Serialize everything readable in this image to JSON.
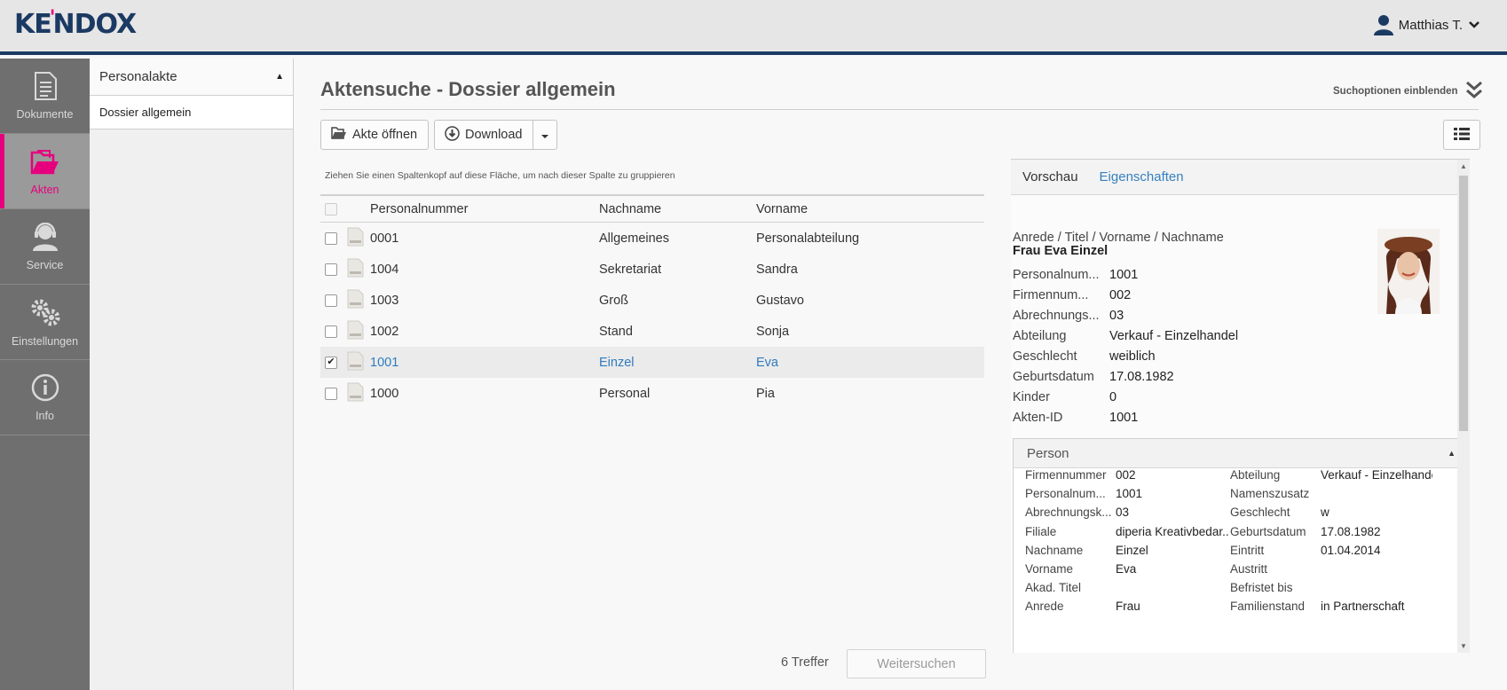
{
  "header": {
    "logo": "KENDOX",
    "user_name": "Matthias T.",
    "colors": {
      "brand_navy": "#1b3a63",
      "brand_pink": "#e6007e",
      "link_blue": "#2f7bbf"
    }
  },
  "leftnav": {
    "items": [
      {
        "label": "Dokumente",
        "icon": "document-icon"
      },
      {
        "label": "Akten",
        "icon": "folder-icon",
        "active": true
      },
      {
        "label": "Service",
        "icon": "headset-icon"
      },
      {
        "label": "Einstellungen",
        "icon": "gears-icon"
      },
      {
        "label": "Info",
        "icon": "info-icon"
      }
    ]
  },
  "subnav": {
    "header": "Personalakte",
    "items": [
      "Dossier allgemein"
    ]
  },
  "main": {
    "title": "Aktensuche - Dossier allgemein",
    "search_options_label": "Suchoptionen einblenden",
    "toolbar": {
      "open_label": "Akte öffnen",
      "download_label": "Download"
    },
    "group_hint": "Ziehen Sie einen Spaltenkopf auf diese Fläche, um nach dieser Spalte zu gruppieren",
    "columns": [
      "Personalnummer",
      "Nachname",
      "Vorname"
    ],
    "rows": [
      {
        "personalnummer": "0001",
        "nachname": "Allgemeines",
        "vorname": "Personalabteilung",
        "checked": false
      },
      {
        "personalnummer": "1004",
        "nachname": "Sekretariat",
        "vorname": "Sandra",
        "checked": false
      },
      {
        "personalnummer": "1003",
        "nachname": "Groß",
        "vorname": "Gustavo",
        "checked": false
      },
      {
        "personalnummer": "1002",
        "nachname": "Stand",
        "vorname": "Sonja",
        "checked": false
      },
      {
        "personalnummer": "1001",
        "nachname": "Einzel",
        "vorname": "Eva",
        "checked": true
      },
      {
        "personalnummer": "1000",
        "nachname": "Personal",
        "vorname": "Pia",
        "checked": false
      }
    ],
    "result_count": "6 Treffer",
    "more_button": "Weitersuchen"
  },
  "detail": {
    "tabs": [
      "Vorschau",
      "Eigenschaften"
    ],
    "heading": "Anrede / Titel / Vorname / Nachname",
    "name": "Frau Eva Einzel",
    "fields": [
      {
        "key": "Personalnum...",
        "value": "1001"
      },
      {
        "key": "Firmennum...",
        "value": "002"
      },
      {
        "key": "Abrechnungs...",
        "value": "03"
      },
      {
        "key": "Abteilung",
        "value": "Verkauf - Einzelhandel"
      },
      {
        "key": "Geschlecht",
        "value": "weiblich"
      },
      {
        "key": "Geburtsdatum",
        "value": "17.08.1982"
      },
      {
        "key": "Kinder",
        "value": "0"
      },
      {
        "key": "Akten-ID",
        "value": "1001"
      }
    ],
    "person": {
      "title": "Person",
      "left": [
        {
          "key": "Firmennummer",
          "value": "002"
        },
        {
          "key": "Personalnum...",
          "value": "1001"
        },
        {
          "key": "Abrechnungsk...",
          "value": "03"
        },
        {
          "key": "Filiale",
          "value": "diperia Kreativbedar..."
        },
        {
          "key": "Nachname",
          "value": "Einzel"
        },
        {
          "key": "Vorname",
          "value": "Eva"
        },
        {
          "key": "Akad. Titel",
          "value": ""
        },
        {
          "key": "Anrede",
          "value": "Frau"
        }
      ],
      "right": [
        {
          "key": "Abteilung",
          "value": "Verkauf - Einzelhande"
        },
        {
          "key": "Namenszusatz",
          "value": ""
        },
        {
          "key": "Geschlecht",
          "value": "w"
        },
        {
          "key": "Geburtsdatum",
          "value": "17.08.1982"
        },
        {
          "key": "Eintritt",
          "value": "01.04.2014"
        },
        {
          "key": "Austritt",
          "value": ""
        },
        {
          "key": "Befristet bis",
          "value": ""
        },
        {
          "key": "Familienstand",
          "value": "in Partnerschaft"
        }
      ]
    }
  }
}
